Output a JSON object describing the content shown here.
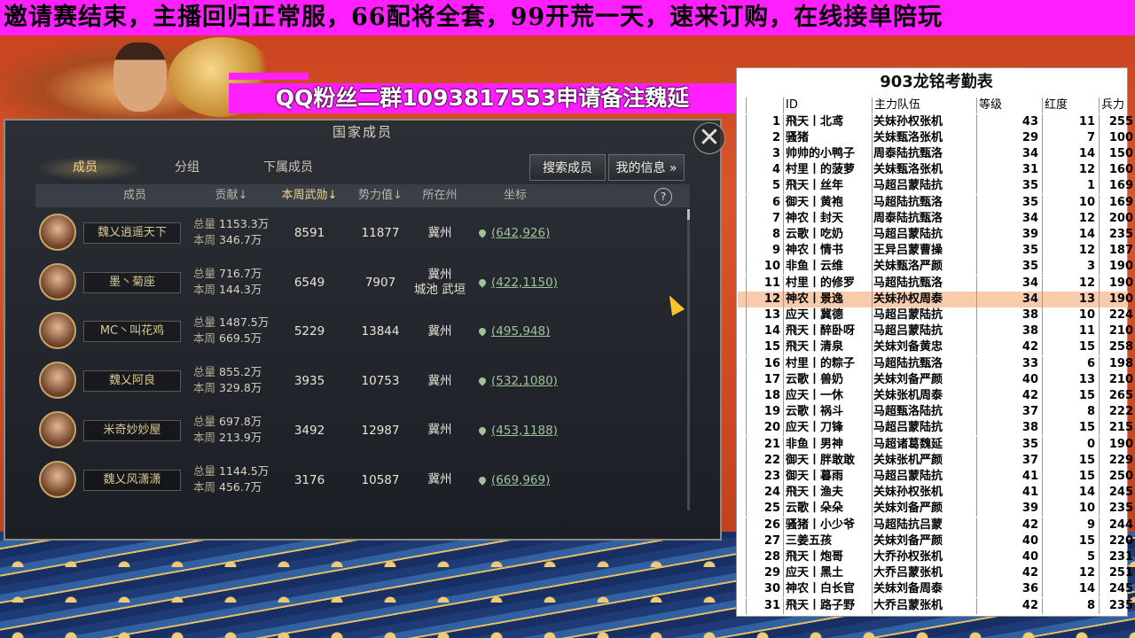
{
  "marquee": "邀请赛结束，主播回归正常服，66配将全套，99开荒一天，速来订购，在线接单陪玩",
  "qq_banner": "QQ粉丝二群1093817553申请备注魏延",
  "panel": {
    "title": "国家成员",
    "close": "✕",
    "tabs": [
      "成员",
      "分组",
      "下属成员"
    ],
    "search_btn": "搜索成员",
    "myinfo_btn": "我的信息 »",
    "headers": [
      "成员",
      "贡献↓",
      "本周武勋↓",
      "势力值↓",
      "所在州",
      "坐标"
    ],
    "help": "?",
    "total_label": "总量",
    "week_label": "本周",
    "members": [
      {
        "name": "魏乂逍遥天下",
        "total": "1153.3万",
        "week": "346.7万",
        "merit": "8591",
        "power": "11877",
        "state": "冀州",
        "state2": "",
        "coord": "(642,926)"
      },
      {
        "name": "墨丶菊座",
        "total": "716.7万",
        "week": "144.3万",
        "merit": "6549",
        "power": "7907",
        "state": "冀州",
        "state2": "城池 武垣",
        "coord": "(422,1150)"
      },
      {
        "name": "MC丶叫花鸡",
        "total": "1487.5万",
        "week": "669.5万",
        "merit": "5229",
        "power": "13844",
        "state": "冀州",
        "state2": "",
        "coord": "(495,948)"
      },
      {
        "name": "魏乂阿良",
        "total": "855.2万",
        "week": "329.8万",
        "merit": "3935",
        "power": "10753",
        "state": "冀州",
        "state2": "",
        "coord": "(532,1080)"
      },
      {
        "name": "米奇妙妙屋",
        "total": "697.8万",
        "week": "213.9万",
        "merit": "3492",
        "power": "12987",
        "state": "冀州",
        "state2": "",
        "coord": "(453,1188)"
      },
      {
        "name": "魏乂风潇潇",
        "total": "1144.5万",
        "week": "456.7万",
        "merit": "3176",
        "power": "10587",
        "state": "冀州",
        "state2": "",
        "coord": "(669,969)"
      }
    ]
  },
  "sheet": {
    "title": "903龙铭考勤表",
    "headers": [
      "ID",
      "主力队伍",
      "等级",
      "红度",
      "兵力"
    ],
    "rows": [
      {
        "no": "1",
        "id": "飛天丨北鸢",
        "team": "关妹孙权张机",
        "lv": "43",
        "red": "11",
        "tr": "255"
      },
      {
        "no": "2",
        "id": "骚猪",
        "team": "关妹甄洛张机",
        "lv": "29",
        "red": "7",
        "tr": "100"
      },
      {
        "no": "3",
        "id": "帅帅的小鸭子",
        "team": "周泰陆抗甄洛",
        "lv": "34",
        "red": "14",
        "tr": "150"
      },
      {
        "no": "4",
        "id": "村里丨的菠萝",
        "team": "关妹甄洛张机",
        "lv": "31",
        "red": "12",
        "tr": "160"
      },
      {
        "no": "5",
        "id": "飛天丨丝年",
        "team": "马超吕蒙陆抗",
        "lv": "35",
        "red": "1",
        "tr": "169"
      },
      {
        "no": "6",
        "id": "御天丨黄袍",
        "team": "马超陆抗甄洛",
        "lv": "35",
        "red": "10",
        "tr": "169"
      },
      {
        "no": "7",
        "id": "神农丨封天",
        "team": "周泰陆抗甄洛",
        "lv": "34",
        "red": "12",
        "tr": "200"
      },
      {
        "no": "8",
        "id": "云歌丨吃奶",
        "team": "马超吕蒙陆抗",
        "lv": "39",
        "red": "14",
        "tr": "235"
      },
      {
        "no": "9",
        "id": "神农丨情书",
        "team": "王异吕蒙曹操",
        "lv": "35",
        "red": "12",
        "tr": "187"
      },
      {
        "no": "10",
        "id": "非鱼丨云维",
        "team": "关妹甄洛严颜",
        "lv": "35",
        "red": "3",
        "tr": "190"
      },
      {
        "no": "11",
        "id": "村里丨的修罗",
        "team": "马超陆抗甄洛",
        "lv": "34",
        "red": "12",
        "tr": "190"
      },
      {
        "no": "12",
        "id": "神农丨景逸",
        "team": "关妹孙权周泰",
        "lv": "34",
        "red": "13",
        "tr": "190",
        "hl": true
      },
      {
        "no": "13",
        "id": "应天丨冀德",
        "team": "马超吕蒙陆抗",
        "lv": "38",
        "red": "10",
        "tr": "224"
      },
      {
        "no": "14",
        "id": "飛天丨醉卧呀",
        "team": "马超吕蒙陆抗",
        "lv": "38",
        "red": "11",
        "tr": "210"
      },
      {
        "no": "15",
        "id": "飛天丨清泉",
        "team": "关妹刘备黄忠",
        "lv": "42",
        "red": "15",
        "tr": "258"
      },
      {
        "no": "16",
        "id": "村里丨的粽子",
        "team": "马超陆抗甄洛",
        "lv": "33",
        "red": "6",
        "tr": "198"
      },
      {
        "no": "17",
        "id": "云歌丨兽奶",
        "team": "关妹刘备严颜",
        "lv": "40",
        "red": "13",
        "tr": "210"
      },
      {
        "no": "18",
        "id": "应天丨一休",
        "team": "关妹张机周泰",
        "lv": "42",
        "red": "15",
        "tr": "265"
      },
      {
        "no": "19",
        "id": "云歌丨祸斗",
        "team": "马超甄洛陆抗",
        "lv": "37",
        "red": "8",
        "tr": "222"
      },
      {
        "no": "20",
        "id": "应天丨刀锋",
        "team": "马超吕蒙陆抗",
        "lv": "38",
        "red": "15",
        "tr": "215"
      },
      {
        "no": "21",
        "id": "非鱼丨男神",
        "team": "马超诸葛魏延",
        "lv": "35",
        "red": "0",
        "tr": "190"
      },
      {
        "no": "22",
        "id": "御天丨胖敢敢",
        "team": "关妹张机严颜",
        "lv": "37",
        "red": "15",
        "tr": "229"
      },
      {
        "no": "23",
        "id": "御天丨暮雨",
        "team": "马超吕蒙陆抗",
        "lv": "41",
        "red": "15",
        "tr": "250"
      },
      {
        "no": "24",
        "id": "飛天丨渔夫",
        "team": "关妹孙权张机",
        "lv": "41",
        "red": "14",
        "tr": "245"
      },
      {
        "no": "25",
        "id": "云歌丨朵朵",
        "team": "关妹刘备严颜",
        "lv": "39",
        "red": "10",
        "tr": "235"
      },
      {
        "no": "26",
        "id": "骚猪丨小少爷",
        "team": "马超陆抗吕蒙",
        "lv": "42",
        "red": "9",
        "tr": "244"
      },
      {
        "no": "27",
        "id": "三姜五孩",
        "team": "关妹刘备严颜",
        "lv": "40",
        "red": "15",
        "tr": "220"
      },
      {
        "no": "28",
        "id": "飛天丨炮哥",
        "team": "大乔孙权张机",
        "lv": "40",
        "red": "5",
        "tr": "231"
      },
      {
        "no": "29",
        "id": "应天丨黑土",
        "team": "大乔吕蒙张机",
        "lv": "42",
        "red": "12",
        "tr": "251"
      },
      {
        "no": "30",
        "id": "神农丨白长官",
        "team": "关妹刘备周泰",
        "lv": "36",
        "red": "14",
        "tr": "245"
      },
      {
        "no": "31",
        "id": "飛天丨路子野",
        "team": "大乔吕蒙张机",
        "lv": "42",
        "red": "8",
        "tr": "235"
      }
    ]
  }
}
